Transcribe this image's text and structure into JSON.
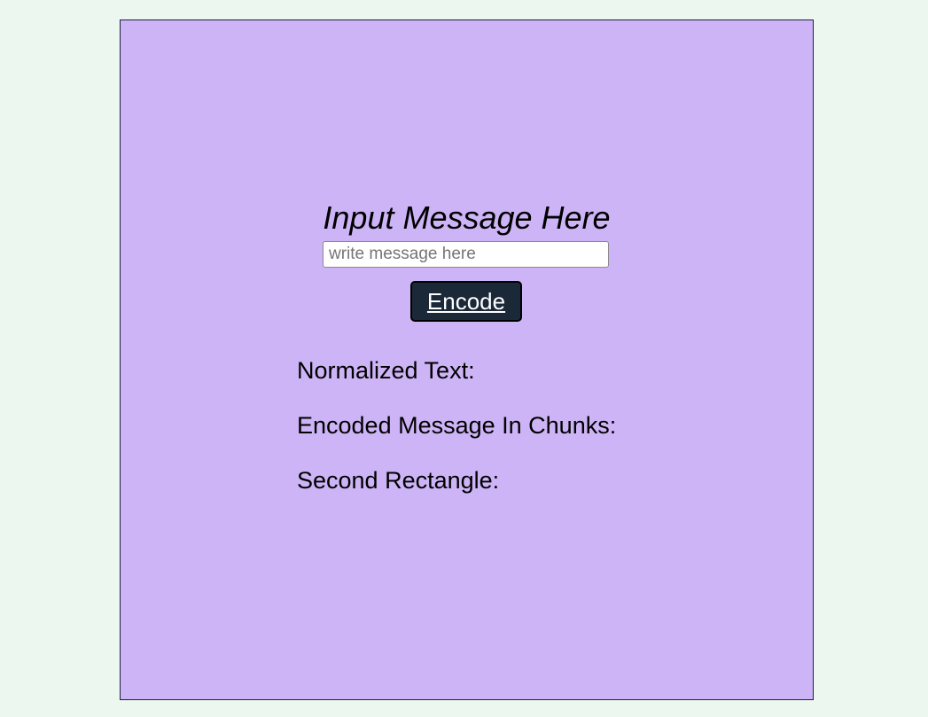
{
  "panel": {
    "title": "Input Message Here",
    "input": {
      "placeholder": "write message here",
      "value": ""
    },
    "encode_button": {
      "label": "Encode"
    }
  },
  "outputs": {
    "normalized_label": "Normalized Text:",
    "encoded_label": "Encoded Message In Chunks:",
    "second_rectangle_label": "Second Rectangle:"
  },
  "colors": {
    "page_background": "#ecf8ef",
    "panel_background": "#cdb4f6",
    "button_background": "#1b2838",
    "button_text": "#ffffff"
  }
}
